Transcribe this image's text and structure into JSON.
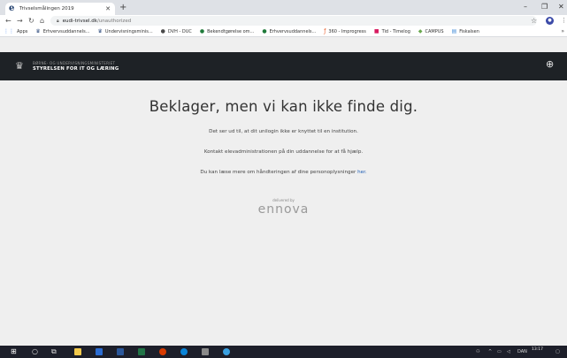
{
  "browser": {
    "tab_title": "Trivselsmålingen 2019",
    "tab_favicon_letter": "e",
    "new_tab_glyph": "+",
    "url_host": "eudi-trivsel.dk",
    "url_path": "/unauthorized"
  },
  "bookmarks": [
    {
      "label": "Apps",
      "icon": "apps-icon",
      "glyph": "⋮⋮",
      "color": "#4285f4"
    },
    {
      "label": "Erhvervsuddannels...",
      "icon": "crown-icon",
      "glyph": "♛",
      "color": "#2c4a7c"
    },
    {
      "label": "Undervisningsminis...",
      "icon": "crown-icon",
      "glyph": "♛",
      "color": "#2c4a7c"
    },
    {
      "label": "DVH - DUC",
      "icon": "circle-logo-icon",
      "glyph": "●",
      "color": "#4a4a4a"
    },
    {
      "label": "Bekendtgørelse om...",
      "icon": "circle-logo-icon",
      "glyph": "●",
      "color": "#1f7a3a"
    },
    {
      "label": "Erhvervsuddannels...",
      "icon": "circle-logo-icon",
      "glyph": "●",
      "color": "#1f7a3a"
    },
    {
      "label": "360 - Improgress",
      "icon": "improgress-icon",
      "glyph": "ƒ",
      "color": "#e8531d"
    },
    {
      "label": "Tid - Timelog",
      "icon": "timelog-icon",
      "glyph": "■",
      "color": "#d81b60"
    },
    {
      "label": "CAMPUS",
      "icon": "campus-icon",
      "glyph": "◆",
      "color": "#6aa84f"
    },
    {
      "label": "Fiskalsen",
      "icon": "folder-icon",
      "glyph": "▤",
      "color": "#4a90d9"
    }
  ],
  "site": {
    "ministry_line": "BØRNE- OG UNDERVISNINGSMINISTERIET",
    "agency_line": "STYRELSEN FOR IT OG LÆRING"
  },
  "content": {
    "headline": "Beklager, men vi kan ikke finde dig.",
    "line1": "Det ser ud til, at dit unilogin ikke er knyttet til en institution.",
    "line2": "Kontakt elevadministrationen på din uddannelse for at få hjælp.",
    "line3_prefix": "Du kan læse mere om håndteringen af dine personoplysninger ",
    "line3_link": "her.",
    "delivered_by": "delivered by",
    "vendor": "ennova"
  },
  "taskbar": {
    "clock_time": "13:17",
    "language": "DAN"
  },
  "colors": {
    "header_bg": "#1e2226",
    "page_bg": "#efefef",
    "link": "#1f5fb4"
  }
}
